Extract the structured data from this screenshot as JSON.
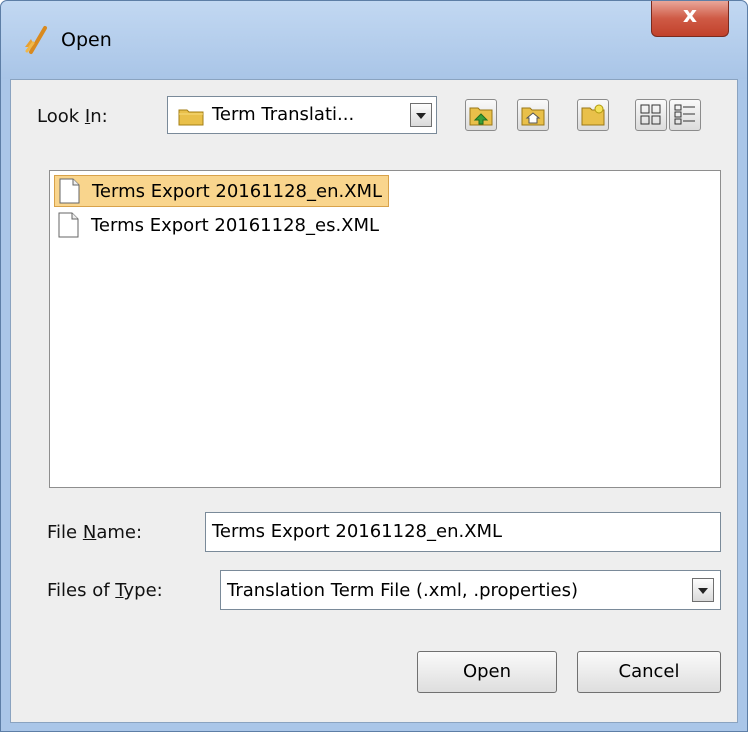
{
  "window": {
    "title": "Open",
    "close_glyph": "x"
  },
  "look_in": {
    "label_pre": "Look ",
    "label_mn": "I",
    "label_post": "n:",
    "value": "Term Translati..."
  },
  "toolbar": {
    "buttons": [
      "up-folder-icon",
      "home-icon",
      "new-folder-icon",
      "list-view-icon",
      "details-view-icon"
    ]
  },
  "files": [
    {
      "name": "Terms Export 20161128_en.XML",
      "selected": true
    },
    {
      "name": "Terms Export 20161128_es.XML",
      "selected": false
    }
  ],
  "file_name": {
    "label_pre": "File ",
    "label_mn": "N",
    "label_post": "ame:",
    "value": "Terms Export 20161128_en.XML"
  },
  "file_type": {
    "label_pre": "Files of ",
    "label_mn": "T",
    "label_post": "ype:",
    "value": "Translation Term File (.xml, .properties)"
  },
  "buttons": {
    "open": "Open",
    "cancel": "Cancel"
  },
  "colors": {
    "selection": "#f9d58d",
    "titlebar": "#aac6e8",
    "close": "#c1412b"
  }
}
